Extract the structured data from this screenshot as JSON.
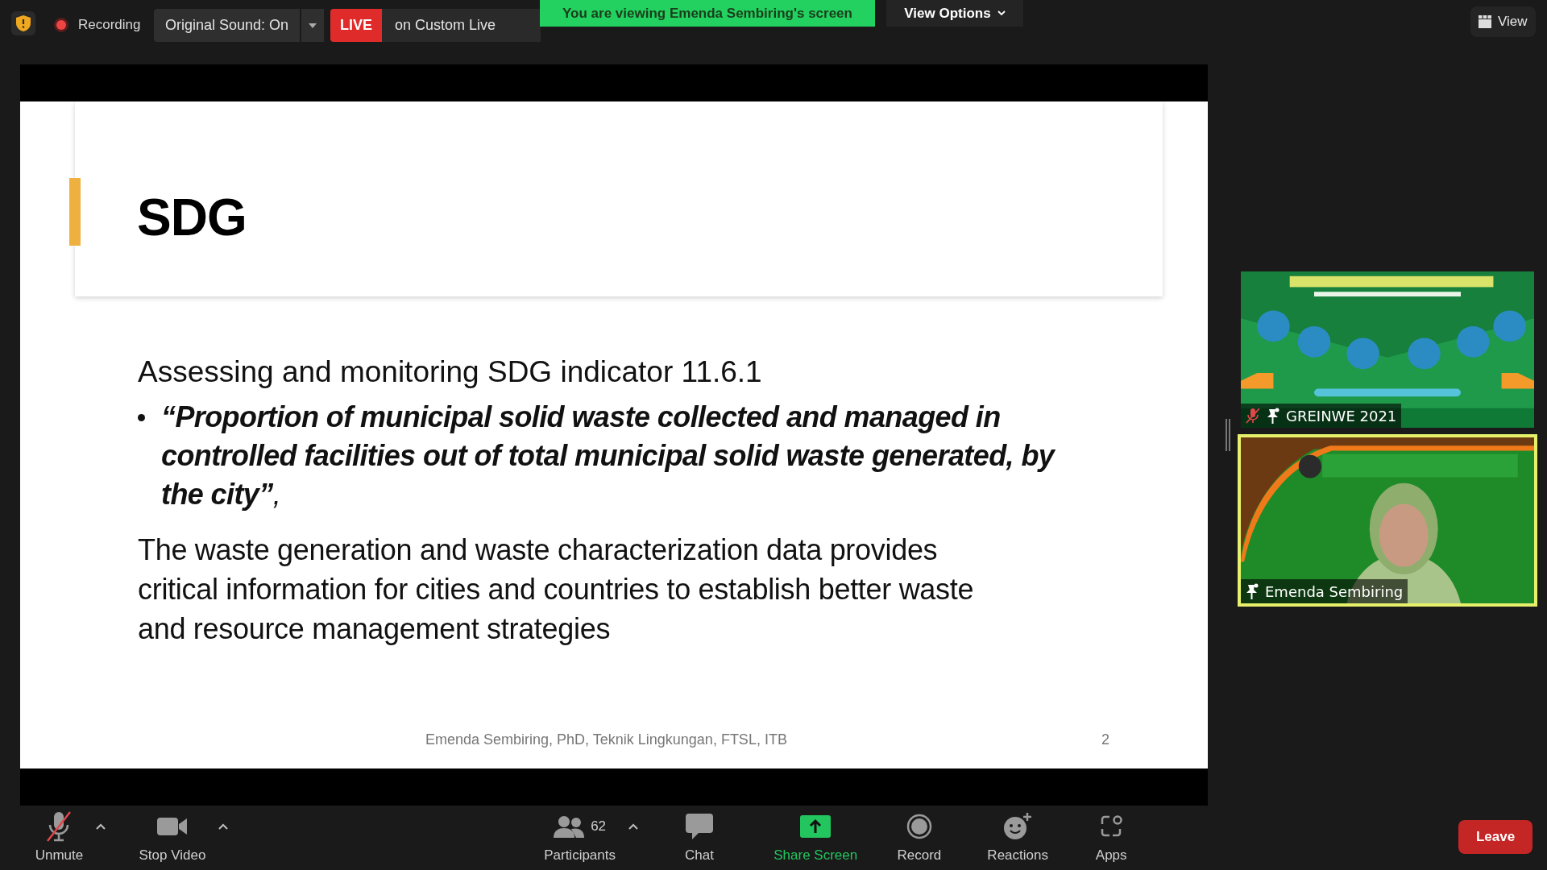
{
  "top_bar": {
    "recording": {
      "label": "Recording",
      "on": true
    },
    "original_sound": "Original Sound: On",
    "live": {
      "badge": "LIVE",
      "service": "on Custom Live"
    },
    "viewing_banner": "You are viewing Emenda Sembiring's screen",
    "view_options": "View Options",
    "view_button": "View"
  },
  "slide": {
    "title": "SDG",
    "heading": "Assessing and monitoring SDG indicator 11.6.1",
    "bullet": "**“Proportion of municipal solid waste collected and managed in controlled facilities out of total municipal solid waste generated, by the city”**,",
    "paragraph": "The waste generation and waste characterization data provides critical information for cities and countries to establish better waste and resource management strategies",
    "footer": "Emenda Sembiring, PhD, Teknik Lingkungan, FTSL, ITB",
    "page": "2"
  },
  "videos": [
    {
      "name": "GREINWE 2021",
      "muted": true,
      "selected": false,
      "kind": "poster"
    },
    {
      "name": "Emenda Sembiring",
      "muted": false,
      "selected": true,
      "kind": "person"
    }
  ],
  "toolbar": [
    {
      "label": "Unmute",
      "kind": "mic",
      "caret": true,
      "active": false
    },
    {
      "label": "Stop Video",
      "kind": "camera",
      "caret": true,
      "active": false
    },
    {
      "label": "Participants",
      "kind": "participants",
      "count": "62",
      "caret": true,
      "active": false
    },
    {
      "label": "Chat",
      "kind": "chat",
      "caret": false,
      "active": false
    },
    {
      "label": "Share Screen",
      "kind": "share",
      "caret": false,
      "active": true
    },
    {
      "label": "Record",
      "kind": "record",
      "caret": false,
      "active": false
    },
    {
      "label": "Reactions",
      "kind": "reactions",
      "caret": false,
      "active": false
    },
    {
      "label": "Apps",
      "kind": "apps",
      "caret": false,
      "active": false
    }
  ],
  "leave": "Leave"
}
